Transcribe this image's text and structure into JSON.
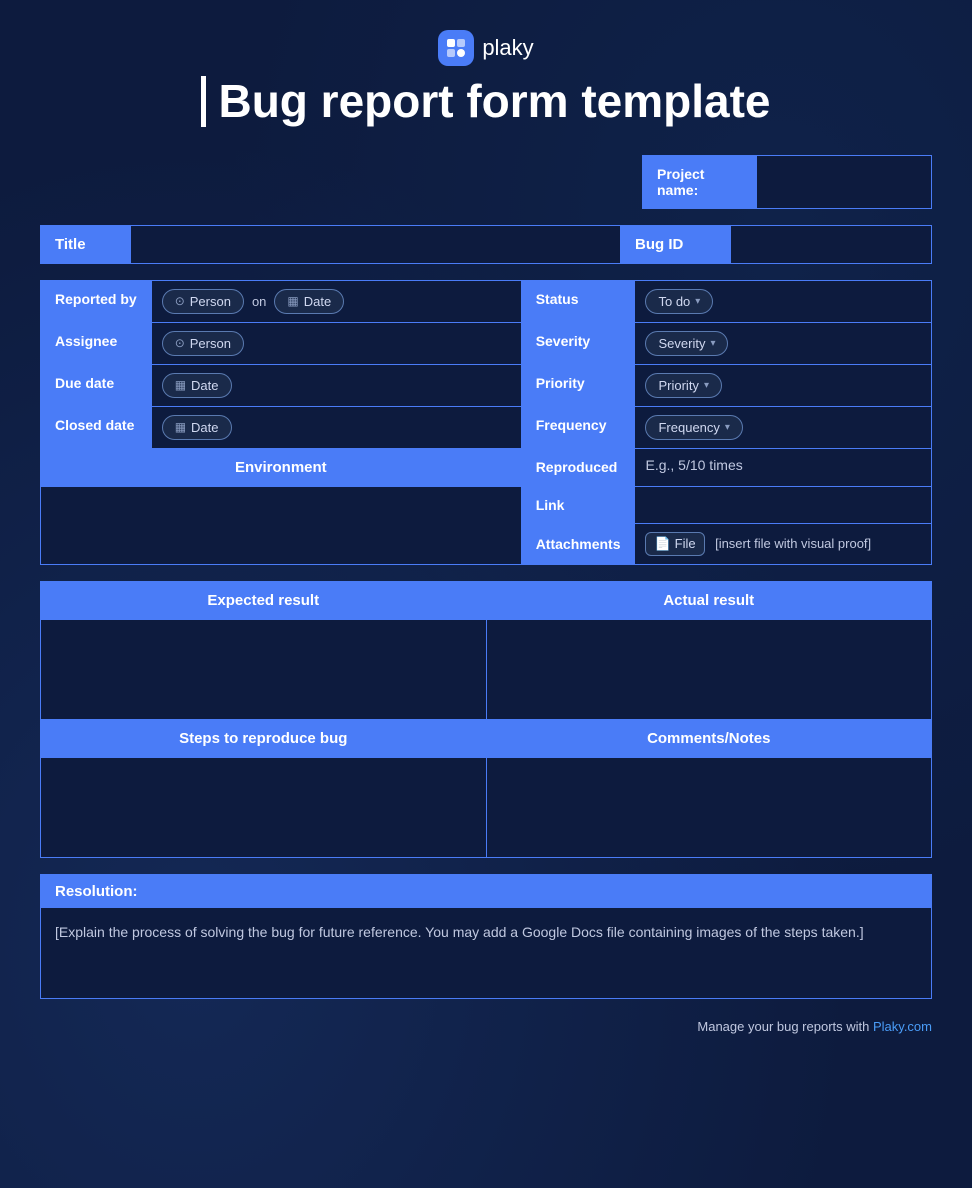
{
  "header": {
    "logo_text": "plaky",
    "logo_symbol": "p",
    "title": "Bug report form template"
  },
  "project": {
    "label": "Project name:",
    "value": ""
  },
  "title_row": {
    "title_label": "Title",
    "title_value": "",
    "bugid_label": "Bug ID",
    "bugid_value": ""
  },
  "form": {
    "reported_by_label": "Reported by",
    "person_label": "Person",
    "on_label": "on",
    "date_label": "Date",
    "assignee_label": "Assignee",
    "due_date_label": "Due date",
    "closed_date_label": "Closed date",
    "status_label": "Status",
    "status_value": "To do",
    "status_arrow": "▾",
    "severity_label": "Severity",
    "severity_value": "Severity",
    "severity_arrow": "▾",
    "priority_label": "Priority",
    "priority_value": "Priority",
    "priority_arrow": "▾",
    "frequency_label": "Frequency",
    "frequency_value": "Frequency",
    "frequency_arrow": "▾",
    "environment_label": "Environment",
    "reproduced_label": "Reproduced",
    "reproduced_value": "E.g., 5/10 times",
    "link_label": "Link",
    "link_value": "",
    "attachments_label": "Attachments",
    "file_label": "File",
    "file_hint": "[insert file with visual proof]"
  },
  "results": {
    "expected_label": "Expected result",
    "expected_value": "",
    "actual_label": "Actual result",
    "actual_value": "",
    "steps_label": "Steps to reproduce bug",
    "steps_value": "",
    "comments_label": "Comments/Notes",
    "comments_value": ""
  },
  "resolution": {
    "label": "Resolution:",
    "value": "[Explain the process of solving the bug for future reference. You may add a Google Docs file containing images of the steps taken.]"
  },
  "footer": {
    "text": "Manage your bug reports with ",
    "link_text": "Plaky.com",
    "link_url": "#"
  },
  "icons": {
    "person": "👤",
    "calendar": "📅",
    "file": "📄"
  }
}
